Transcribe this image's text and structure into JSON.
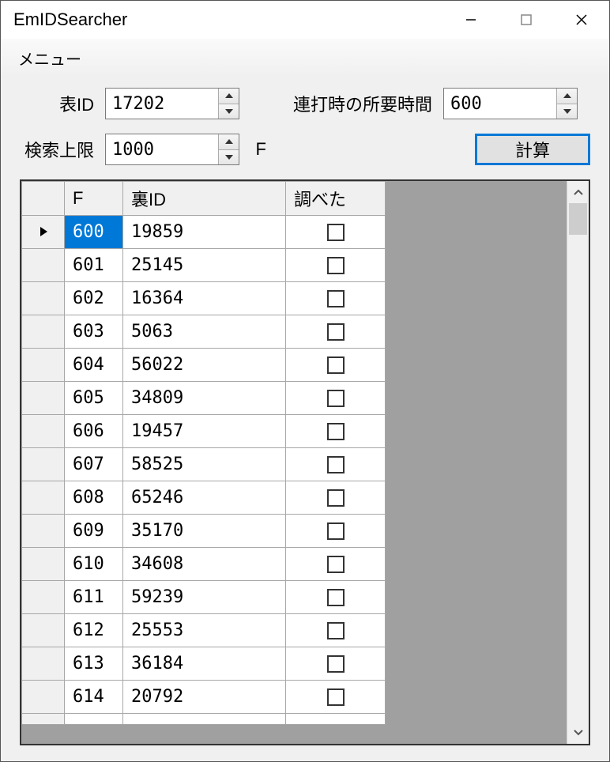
{
  "window": {
    "title": "EmIDSearcher"
  },
  "menu": {
    "label": "メニュー"
  },
  "form": {
    "tableId": {
      "label": "表ID",
      "value": "17202"
    },
    "elapsed": {
      "label": "連打時の所要時間",
      "value": "600"
    },
    "searchLimit": {
      "label": "検索上限",
      "value": "1000"
    },
    "unit": "F",
    "calc": "計算"
  },
  "grid": {
    "headers": {
      "rowhead": "",
      "f": "F",
      "uid": "裏ID",
      "checked": "調べた"
    },
    "rows": [
      {
        "f": "600",
        "uid": "19859",
        "checked": false,
        "selected": true,
        "current": true
      },
      {
        "f": "601",
        "uid": "25145",
        "checked": false
      },
      {
        "f": "602",
        "uid": "16364",
        "checked": false
      },
      {
        "f": "603",
        "uid": "5063",
        "checked": false
      },
      {
        "f": "604",
        "uid": "56022",
        "checked": false
      },
      {
        "f": "605",
        "uid": "34809",
        "checked": false
      },
      {
        "f": "606",
        "uid": "19457",
        "checked": false
      },
      {
        "f": "607",
        "uid": "58525",
        "checked": false
      },
      {
        "f": "608",
        "uid": "65246",
        "checked": false
      },
      {
        "f": "609",
        "uid": "35170",
        "checked": false
      },
      {
        "f": "610",
        "uid": "34608",
        "checked": false
      },
      {
        "f": "611",
        "uid": "59239",
        "checked": false
      },
      {
        "f": "612",
        "uid": "25553",
        "checked": false
      },
      {
        "f": "613",
        "uid": "36184",
        "checked": false
      },
      {
        "f": "614",
        "uid": "20792",
        "checked": false
      }
    ]
  }
}
